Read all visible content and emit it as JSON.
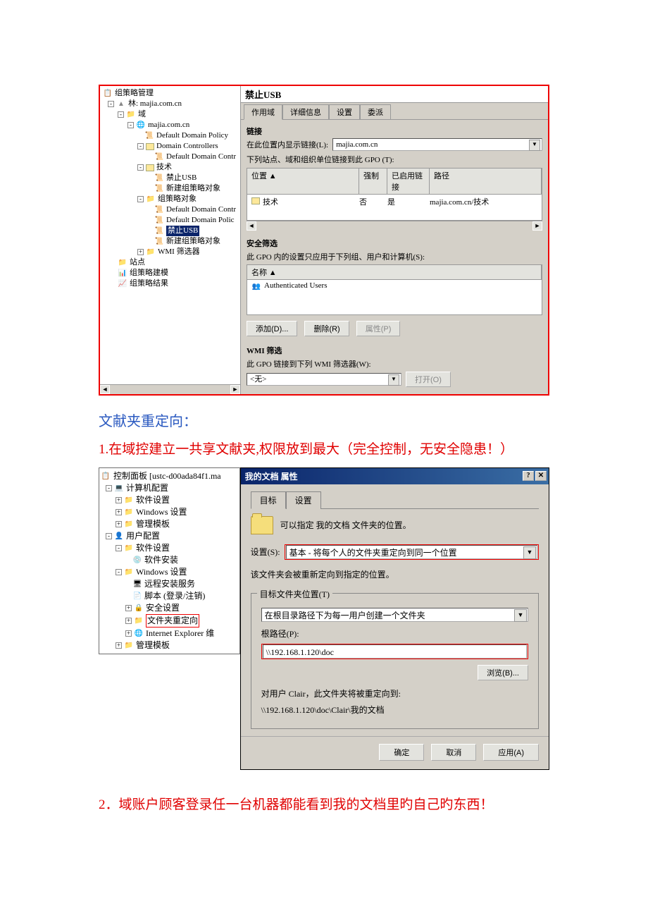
{
  "gpmc": {
    "root": "组策略管理",
    "forest": "林: majia.com.cn",
    "domains_node": "域",
    "domain": "majia.com.cn",
    "ddp": "Default Domain Policy",
    "dc": "Domain Controllers",
    "ddc": "Default Domain Contr",
    "tech": "技术",
    "usb": "禁止USB",
    "newgpo": "新建组策略对象",
    "gpo_node": "组策略对象",
    "ddc2": "Default Domain Contr",
    "ddp2": "Default Domain Polic",
    "usb2": "禁止USB",
    "newgpo2": "新建组策略对象",
    "wmi": "WMI 筛选器",
    "sites": "站点",
    "modeling": "组策略建模",
    "results": "组策略结果"
  },
  "details": {
    "title": "禁止USB",
    "tabs": [
      "作用域",
      "详细信息",
      "设置",
      "委派"
    ],
    "links_title": "链接",
    "show_links_label": "在此位置内显示链接(L):",
    "dropdown_value": "majia.com.cn",
    "linked_label": "下列站点、域和组织单位链接到此 GPO (T):",
    "cols": {
      "loc": "位置 ▲",
      "enforced": "强制",
      "enabled": "已启用链接",
      "path": "路径"
    },
    "row": {
      "loc": "技术",
      "enforced": "否",
      "enabled": "是",
      "path": "majia.com.cn/技术"
    },
    "secfilter_title": "安全筛选",
    "secfilter_label": "此 GPO 内的设置只应用于下列组、用户和计算机(S):",
    "name_col": "名称 ▲",
    "auth_users": "Authenticated Users",
    "add_btn": "添加(D)...",
    "remove_btn": "删除(R)",
    "props_btn": "属性(P)",
    "wmi_title": "WMI 筛选",
    "wmi_label": "此 GPO 链接到下列 WMI 筛选器(W):",
    "wmi_value": "<无>",
    "open_btn": "打开(O)"
  },
  "section1_title": "文献夹重定向：",
  "section1_step": "1.在域控建立一共享文献夹,权限放到最大（完全控制，无安全隐患！）",
  "gpo_editor": {
    "title": "控制面板 [ustc-d00ada84f1.ma",
    "computer": "计算机配置",
    "software": "软件设置",
    "windows": "Windows 设置",
    "admin": "管理模板",
    "user": "用户配置",
    "soft_install": "软件安装",
    "remote": "远程安装服务",
    "scripts": "脚本 (登录/注销)",
    "security": "安全设置",
    "folder_redir": "文件夹重定向",
    "ie": "Internet Explorer 维"
  },
  "dialog": {
    "title": "我的文档 属性",
    "tabs": [
      "目标",
      "设置"
    ],
    "desc": "可以指定 我的文档 文件夹的位置。",
    "setting_label": "设置(S):",
    "setting_value": "基本 - 将每个人的文件夹重定向到同一个位置",
    "note": "该文件夹会被重新定向到指定的位置。",
    "target_legend": "目标文件夹位置(T)",
    "target_drop": "在根目录路径下为每一用户创建一个文件夹",
    "root_label": "根路径(P):",
    "root_value": "\\\\192.168.1.120\\doc",
    "browse": "浏览(B)...",
    "redirect_note1": "对用户 Clair，此文件夹将被重定向到:",
    "redirect_note2": "\\\\192.168.1.120\\doc\\Clair\\我的文档",
    "ok": "确定",
    "cancel": "取消",
    "apply": "应用(A)"
  },
  "section2_step": "2．域账户顾客登录任一台机器都能看到我的文档里旳自己旳东西！"
}
